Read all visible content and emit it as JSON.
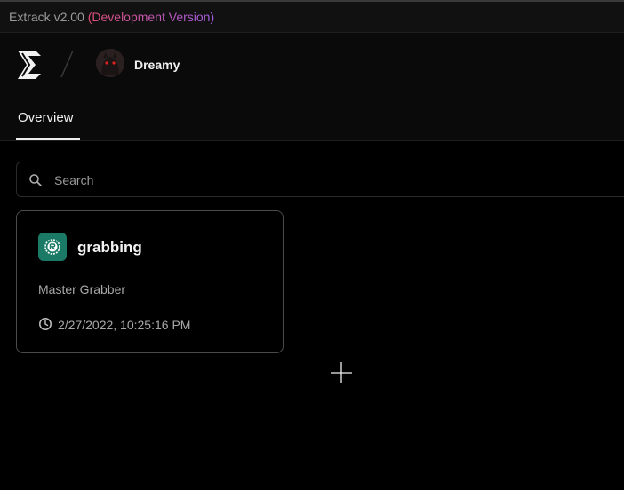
{
  "window": {
    "app_title": "Extrack v2.00",
    "dev_label": "(Development Version)"
  },
  "header": {
    "username": "Dreamy"
  },
  "tabs": [
    {
      "label": "Overview",
      "active": true
    }
  ],
  "search": {
    "placeholder": "Search",
    "value": ""
  },
  "projects": [
    {
      "name": "grabbing",
      "description": "Master Grabber",
      "timestamp": "2/27/2022, 10:25:16 PM",
      "icon": "rust-icon",
      "badge_color": "#1a7a66"
    }
  ],
  "icons": {
    "logo": "extrack-logo",
    "search": "search-icon",
    "clock": "clock-icon",
    "cursor": "crosshair-cursor"
  }
}
